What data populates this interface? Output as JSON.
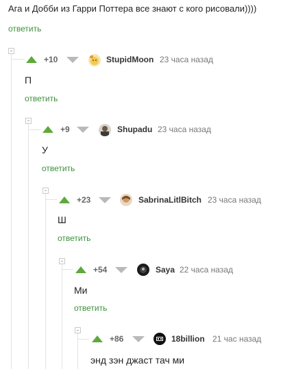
{
  "top_comment": {
    "text": "Ага и Добби из Гарри Поттера все знают с кого рисовали))))",
    "reply": "ответить"
  },
  "comments": [
    {
      "rating": "+10",
      "username": "StupidMoon",
      "time": "23 часа назад",
      "text": "П",
      "reply": "ответить",
      "avatar_icon": "avatar-cartoon-icon"
    },
    {
      "rating": "+9",
      "username": "Shupadu",
      "time": "23 часа назад",
      "text": "У",
      "reply": "ответить",
      "avatar_icon": "avatar-photo-icon"
    },
    {
      "rating": "+23",
      "username": "SabrinaLitlBitch",
      "time": "23 часа назад",
      "text": "Ш",
      "reply": "ответить",
      "avatar_icon": "avatar-photo-icon"
    },
    {
      "rating": "+54",
      "username": "Saya",
      "time": "22 часа назад",
      "text": "Ми",
      "reply": "ответить",
      "avatar_icon": "avatar-dark-icon"
    },
    {
      "rating": "+86",
      "username": "18billion",
      "time": "21 час назад",
      "text": "энд зэн джаст тач ми",
      "reply": "",
      "avatar_icon": "avatar-logo-icon"
    }
  ],
  "colors": {
    "upvote": "#5fa83b",
    "downvote": "#b9b9b9",
    "reply_link": "#3d8f3d",
    "thread_line": "#e3e3e3"
  }
}
